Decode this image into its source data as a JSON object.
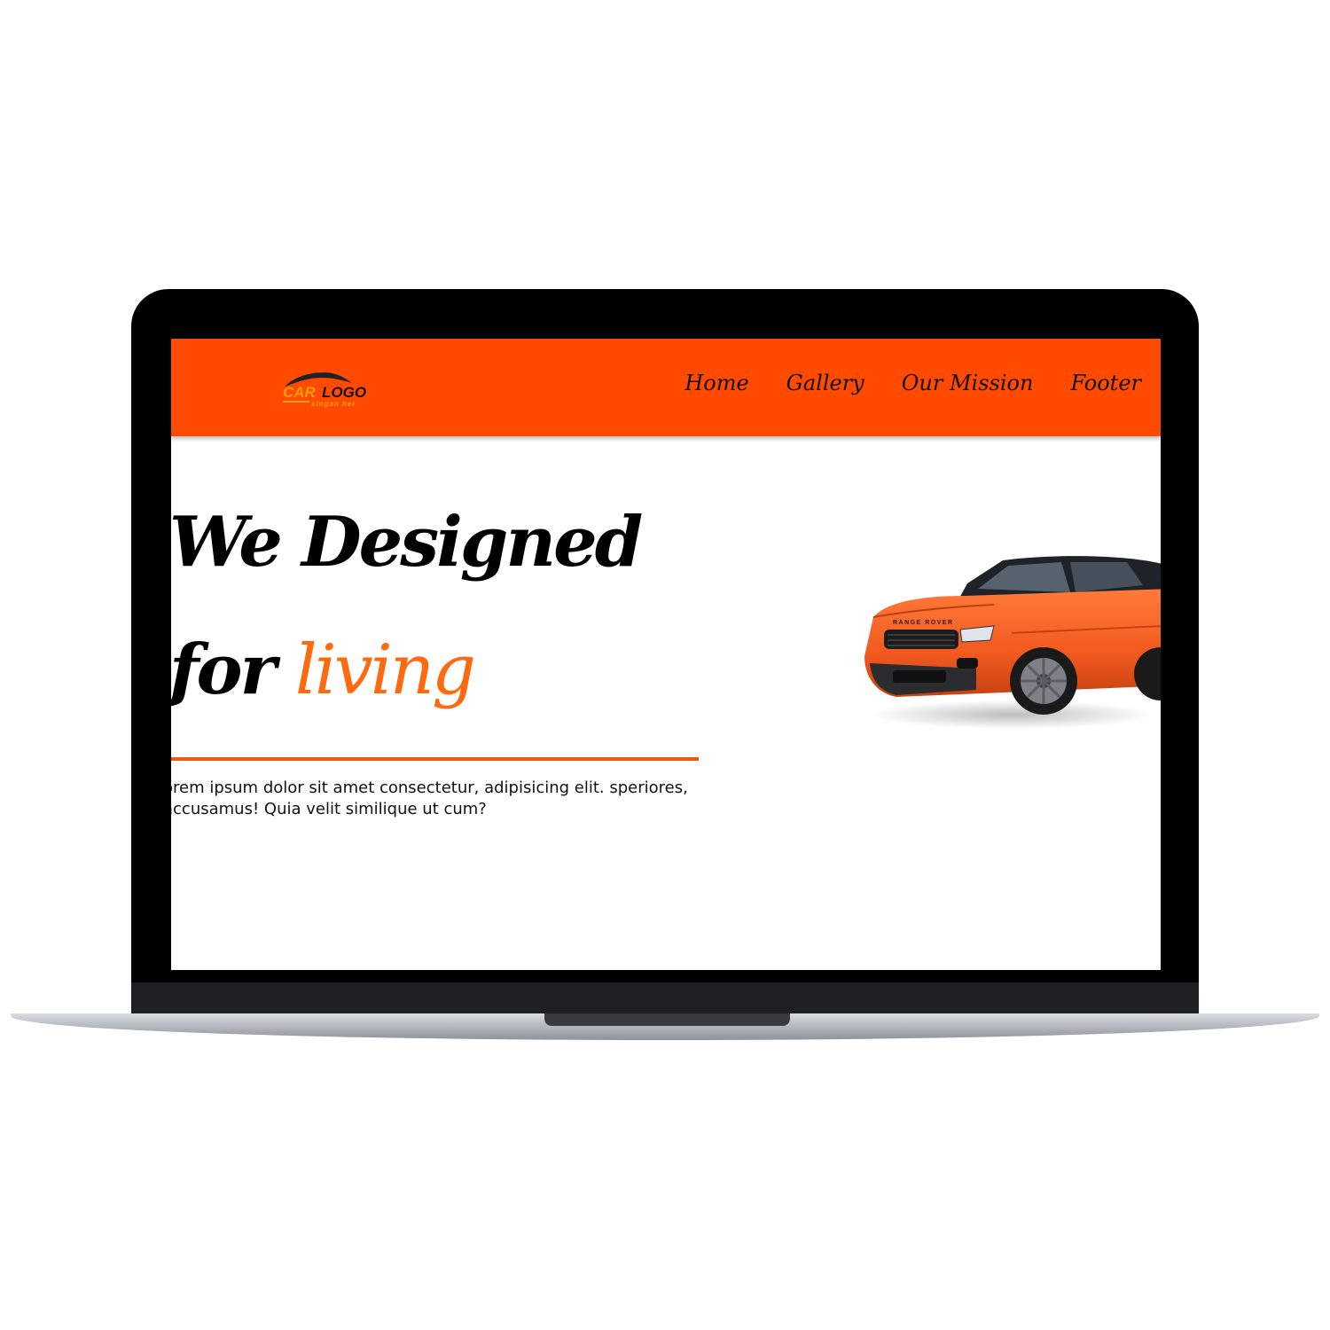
{
  "colors": {
    "brand": "#ff4a00",
    "accent_text": "#ff6a10",
    "rule": "#f05a10",
    "frame": "#000000"
  },
  "logo": {
    "word_1": "CAR",
    "word_2": "LOGO",
    "slogan": "slogan her"
  },
  "nav": {
    "items": [
      {
        "label": "Home"
      },
      {
        "label": "Gallery"
      },
      {
        "label": "Our Mission"
      },
      {
        "label": "Footer"
      }
    ]
  },
  "hero": {
    "title_line_1": "We Designed",
    "title_line_2_lead": "for",
    "title_accent": "living",
    "body": "orem ipsum dolor sit amet consectetur, adipisicing elit. speriores, accusamus! Quia velit similique ut cum?"
  },
  "car": {
    "plate_text": "RANGE ROVER",
    "body_color": "#f2591f",
    "roof_color": "#1f2226",
    "icon": "suv-car-image"
  }
}
